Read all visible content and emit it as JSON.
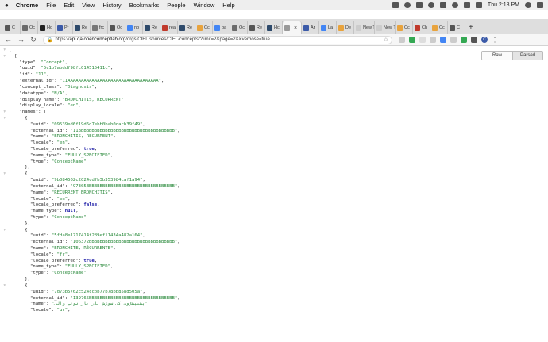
{
  "menubar": {
    "app": "Chrome",
    "items": [
      "File",
      "Edit",
      "View",
      "History",
      "Bookmarks",
      "People",
      "Window",
      "Help"
    ],
    "clock": "Thu 2:18 PM"
  },
  "tabs": [
    {
      "label": "C",
      "color": "#555555"
    },
    {
      "label": "Oc",
      "color": "#6b6b6b"
    },
    {
      "label": "Hc",
      "color": "#222222"
    },
    {
      "label": "Pr",
      "color": "#3b5aa8"
    },
    {
      "label": "Re",
      "color": "#2e4a6b"
    },
    {
      "label": "frc",
      "color": "#777777"
    },
    {
      "label": "Oc",
      "color": "#555555"
    },
    {
      "label": "np",
      "color": "#4285f4"
    },
    {
      "label": "Re",
      "color": "#2e4a6b"
    },
    {
      "label": "rea",
      "color": "#c0392b"
    },
    {
      "label": "Re",
      "color": "#2e4a6b"
    },
    {
      "label": "Cc",
      "color": "#e8a33d"
    },
    {
      "label": "pa",
      "color": "#4285f4"
    },
    {
      "label": "Oc",
      "color": "#6b6b6b"
    },
    {
      "label": "Re",
      "color": "#555555"
    },
    {
      "label": "Hc",
      "color": "#2e4a6b"
    },
    {
      "label": "",
      "color": "#999999",
      "active": true
    },
    {
      "label": "Ar",
      "color": "#3b5aa8"
    },
    {
      "label": "La",
      "color": "#4285f4"
    },
    {
      "label": "De",
      "color": "#e8a33d"
    },
    {
      "label": "New T",
      "color": "#cccccc"
    },
    {
      "label": "New T",
      "color": "#cccccc"
    },
    {
      "label": "Cc",
      "color": "#e8a33d"
    },
    {
      "label": "Ch",
      "color": "#c0392b"
    },
    {
      "label": "Cc",
      "color": "#e8a33d"
    },
    {
      "label": "C",
      "color": "#555555"
    }
  ],
  "toolbar": {
    "url_scheme": "https://",
    "url_host": "api.qa.openconceptlab.org",
    "url_path": "/orgs/CIEL/sources/CIEL/concepts/?limit=2&page=2&&verbose=true",
    "extension_colors": [
      "#cccccc",
      "#34a853",
      "#dddddd",
      "#cccccc",
      "#4285f4",
      "#cccccc",
      "#34a853",
      "#555555"
    ],
    "avatar_initial": "C"
  },
  "viewer": {
    "raw_label": "Raw",
    "parsed_label": "Parsed"
  },
  "colors": {
    "string": "#28893a",
    "bool": "#1a1aa6"
  },
  "json_lines": [
    {
      "toggle": "▿",
      "indent": 0,
      "parts": [
        [
          "p",
          "["
        ]
      ]
    },
    {
      "toggle": "▿",
      "indent": 1,
      "parts": [
        [
          "p",
          "{"
        ]
      ]
    },
    {
      "indent": 2,
      "parts": [
        [
          "k",
          "\"type\""
        ],
        [
          "p",
          ": "
        ],
        [
          "s",
          "\"Concept\""
        ],
        [
          "p",
          ","
        ]
      ]
    },
    {
      "indent": 2,
      "parts": [
        [
          "k",
          "\"uuid\""
        ],
        [
          "p",
          ": "
        ],
        [
          "s",
          "\"5c1b7abddf98fc014515411c\""
        ],
        [
          "p",
          ","
        ]
      ]
    },
    {
      "indent": 2,
      "parts": [
        [
          "k",
          "\"id\""
        ],
        [
          "p",
          ": "
        ],
        [
          "s",
          "\"11\""
        ],
        [
          "p",
          ","
        ]
      ]
    },
    {
      "indent": 2,
      "parts": [
        [
          "k",
          "\"external_id\""
        ],
        [
          "p",
          ": "
        ],
        [
          "s",
          "\"11AAAAAAAAAAAAAAAAAAAAAAAAAAAAAAAAAA\""
        ],
        [
          "p",
          ","
        ]
      ]
    },
    {
      "indent": 2,
      "parts": [
        [
          "k",
          "\"concept_class\""
        ],
        [
          "p",
          ": "
        ],
        [
          "s",
          "\"Diagnosis\""
        ],
        [
          "p",
          ","
        ]
      ]
    },
    {
      "indent": 2,
      "parts": [
        [
          "k",
          "\"datatype\""
        ],
        [
          "p",
          ": "
        ],
        [
          "s",
          "\"N/A\""
        ],
        [
          "p",
          ","
        ]
      ]
    },
    {
      "indent": 2,
      "parts": [
        [
          "k",
          "\"display_name\""
        ],
        [
          "p",
          ": "
        ],
        [
          "s",
          "\"BRONCHITIS, RECURRENT\""
        ],
        [
          "p",
          ","
        ]
      ]
    },
    {
      "indent": 2,
      "parts": [
        [
          "k",
          "\"display_locale\""
        ],
        [
          "p",
          ": "
        ],
        [
          "s",
          "\"en\""
        ],
        [
          "p",
          ","
        ]
      ]
    },
    {
      "toggle": "▿",
      "indent": 2,
      "parts": [
        [
          "k",
          "\"names\""
        ],
        [
          "p",
          ": ["
        ]
      ]
    },
    {
      "toggle": "▿",
      "indent": 3,
      "parts": [
        [
          "p",
          "{"
        ]
      ]
    },
    {
      "indent": 4,
      "parts": [
        [
          "k",
          "\"uuid\""
        ],
        [
          "p",
          ": "
        ],
        [
          "s",
          "\"09539ed6f19d6d7ebb0bab0dacb39f49\""
        ],
        [
          "p",
          ","
        ]
      ]
    },
    {
      "indent": 4,
      "parts": [
        [
          "k",
          "\"external_id\""
        ],
        [
          "p",
          ": "
        ],
        [
          "s",
          "\"118BBBBBBBBBBBBBBBBBBBBBBBBBBBBBBBBBBB\""
        ],
        [
          "p",
          ","
        ]
      ]
    },
    {
      "indent": 4,
      "parts": [
        [
          "k",
          "\"name\""
        ],
        [
          "p",
          ": "
        ],
        [
          "s",
          "\"BRONCHITIS, RECURRENT\""
        ],
        [
          "p",
          ","
        ]
      ]
    },
    {
      "indent": 4,
      "parts": [
        [
          "k",
          "\"locale\""
        ],
        [
          "p",
          ": "
        ],
        [
          "s",
          "\"en\""
        ],
        [
          "p",
          ","
        ]
      ]
    },
    {
      "indent": 4,
      "parts": [
        [
          "k",
          "\"locale_preferred\""
        ],
        [
          "p",
          ": "
        ],
        [
          "b",
          "true"
        ],
        [
          "p",
          ","
        ]
      ]
    },
    {
      "indent": 4,
      "parts": [
        [
          "k",
          "\"name_type\""
        ],
        [
          "p",
          ": "
        ],
        [
          "s",
          "\"FULLY_SPECIFIED\""
        ],
        [
          "p",
          ","
        ]
      ]
    },
    {
      "indent": 4,
      "parts": [
        [
          "k",
          "\"type\""
        ],
        [
          "p",
          ": "
        ],
        [
          "s",
          "\"ConceptName\""
        ]
      ]
    },
    {
      "indent": 3,
      "parts": [
        [
          "p",
          "},"
        ]
      ]
    },
    {
      "toggle": "▿",
      "indent": 3,
      "parts": [
        [
          "p",
          "{"
        ]
      ]
    },
    {
      "indent": 4,
      "parts": [
        [
          "k",
          "\"uuid\""
        ],
        [
          "p",
          ": "
        ],
        [
          "s",
          "\"9b084502c2024cdfb3b353984caf1a94\""
        ],
        [
          "p",
          ","
        ]
      ]
    },
    {
      "indent": 4,
      "parts": [
        [
          "k",
          "\"external_id\""
        ],
        [
          "p",
          ": "
        ],
        [
          "s",
          "\"97305BBBBBBBBBBBBBBBBBBBBBBBBBBBBBBBBB\""
        ],
        [
          "p",
          ","
        ]
      ]
    },
    {
      "indent": 4,
      "parts": [
        [
          "k",
          "\"name\""
        ],
        [
          "p",
          ": "
        ],
        [
          "s",
          "\"RECURRENT BRONCHITIS\""
        ],
        [
          "p",
          ","
        ]
      ]
    },
    {
      "indent": 4,
      "parts": [
        [
          "k",
          "\"locale\""
        ],
        [
          "p",
          ": "
        ],
        [
          "s",
          "\"en\""
        ],
        [
          "p",
          ","
        ]
      ]
    },
    {
      "indent": 4,
      "parts": [
        [
          "k",
          "\"locale_preferred\""
        ],
        [
          "p",
          ": "
        ],
        [
          "b",
          "false"
        ],
        [
          "p",
          ","
        ]
      ]
    },
    {
      "indent": 4,
      "parts": [
        [
          "k",
          "\"name_type\""
        ],
        [
          "p",
          ": "
        ],
        [
          "b",
          "null"
        ],
        [
          "p",
          ","
        ]
      ]
    },
    {
      "indent": 4,
      "parts": [
        [
          "k",
          "\"type\""
        ],
        [
          "p",
          ": "
        ],
        [
          "s",
          "\"ConceptName\""
        ]
      ]
    },
    {
      "indent": 3,
      "parts": [
        [
          "p",
          "},"
        ]
      ]
    },
    {
      "toggle": "▿",
      "indent": 3,
      "parts": [
        [
          "p",
          "{"
        ]
      ]
    },
    {
      "indent": 4,
      "parts": [
        [
          "k",
          "\"uuid\""
        ],
        [
          "p",
          ": "
        ],
        [
          "s",
          "\"5fda8e1717414f289ef11434a482a164\""
        ],
        [
          "p",
          ","
        ]
      ]
    },
    {
      "indent": 4,
      "parts": [
        [
          "k",
          "\"external_id\""
        ],
        [
          "p",
          ": "
        ],
        [
          "s",
          "\"106372BBBBBBBBBBBBBBBBBBBBBBBBBBBBBBBB\""
        ],
        [
          "p",
          ","
        ]
      ]
    },
    {
      "indent": 4,
      "parts": [
        [
          "k",
          "\"name\""
        ],
        [
          "p",
          ": "
        ],
        [
          "s",
          "\"BRONCHITE, RÉCURRENTE\""
        ],
        [
          "p",
          ","
        ]
      ]
    },
    {
      "indent": 4,
      "parts": [
        [
          "k",
          "\"locale\""
        ],
        [
          "p",
          ": "
        ],
        [
          "s",
          "\"fr\""
        ],
        [
          "p",
          ","
        ]
      ]
    },
    {
      "indent": 4,
      "parts": [
        [
          "k",
          "\"locale_preferred\""
        ],
        [
          "p",
          ": "
        ],
        [
          "b",
          "true"
        ],
        [
          "p",
          ","
        ]
      ]
    },
    {
      "indent": 4,
      "parts": [
        [
          "k",
          "\"name_type\""
        ],
        [
          "p",
          ": "
        ],
        [
          "s",
          "\"FULLY_SPECIFIED\""
        ],
        [
          "p",
          ","
        ]
      ]
    },
    {
      "indent": 4,
      "parts": [
        [
          "k",
          "\"type\""
        ],
        [
          "p",
          ": "
        ],
        [
          "s",
          "\"ConceptName\""
        ]
      ]
    },
    {
      "indent": 3,
      "parts": [
        [
          "p",
          "},"
        ]
      ]
    },
    {
      "toggle": "▿",
      "indent": 3,
      "parts": [
        [
          "p",
          "{"
        ]
      ]
    },
    {
      "indent": 4,
      "parts": [
        [
          "k",
          "\"uuid\""
        ],
        [
          "p",
          ": "
        ],
        [
          "s",
          "\"7d73b5762c524ccob77b78bb858d505a\""
        ],
        [
          "p",
          ","
        ]
      ]
    },
    {
      "indent": 4,
      "parts": [
        [
          "k",
          "\"external_id\""
        ],
        [
          "p",
          ": "
        ],
        [
          "s",
          "\"139765BBBBBBBBBBBBBBBBBBBBBBBBBBBBBBBB\""
        ],
        [
          "p",
          ","
        ]
      ]
    },
    {
      "indent": 4,
      "parts": [
        [
          "k",
          "\"name\""
        ],
        [
          "p",
          ": "
        ],
        [
          "s",
          "\"پھیپھڑوں کی سوزش بار بار ہونے والی\""
        ],
        [
          "p",
          ","
        ]
      ]
    },
    {
      "indent": 4,
      "parts": [
        [
          "k",
          "\"locale\""
        ],
        [
          "p",
          ": "
        ],
        [
          "s",
          "\"ur\""
        ],
        [
          "p",
          ","
        ]
      ]
    }
  ]
}
